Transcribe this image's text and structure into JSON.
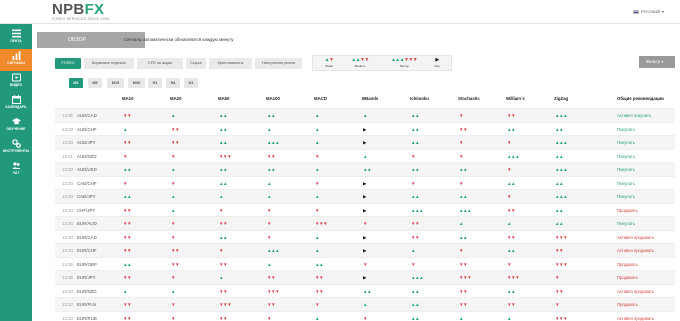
{
  "logo": {
    "text_main": "NPB",
    "text_fx": "FX",
    "subtitle": "FOREX SERVICES SINCE 1994"
  },
  "language": {
    "label": "РУССКИЙ",
    "arrow": "▾"
  },
  "sidebar": {
    "items": [
      {
        "label": "ЛЕНТА",
        "icon": "feed-icon",
        "active": false
      },
      {
        "label": "СИГНАЛЫ",
        "icon": "chart-icon",
        "active": true
      },
      {
        "label": "ВИДЕО",
        "icon": "video-icon",
        "active": false
      },
      {
        "label": "КАЛЕНДАРЬ",
        "icon": "calendar-icon",
        "active": false
      },
      {
        "label": "ОБУЧЕНИЕ",
        "icon": "education-icon",
        "active": false
      },
      {
        "label": "ИНСТРУМЕНТЫ",
        "icon": "tools-icon",
        "active": false
      },
      {
        "label": "ЧАТ",
        "icon": "chat-icon",
        "active": false
      }
    ]
  },
  "overview": {
    "tab_label": "ОБЗОР",
    "note": "Сигналы автоматически обновляются каждую минуту"
  },
  "categories": [
    "FOREX",
    "Биржевые индексы",
    "CFD на акции",
    "Сырье",
    "Криптовалюты",
    "Настроения рынка"
  ],
  "legend": [
    {
      "label": "Weak",
      "arrows": "▲▼",
      "colors": [
        "#2aa27c",
        "#d64545"
      ]
    },
    {
      "label": "Medium",
      "arrows": "▲▲▼▼",
      "colors": [
        "#2aa27c",
        "#d64545"
      ]
    },
    {
      "label": "Strong",
      "arrows": "▲▲▲▼▼▼",
      "colors": [
        "#2aa27c",
        "#d64545"
      ]
    },
    {
      "label": "Flat",
      "arrows": "▶",
      "colors": [
        "#111",
        "#111"
      ]
    }
  ],
  "filter": {
    "label": "Фильтр",
    "arrow": "▾"
  },
  "timeframes": [
    "M1",
    "M5",
    "M15",
    "M30",
    "H1",
    "H4",
    "D1"
  ],
  "table": {
    "columns": [
      "MA10",
      "MA20",
      "MA50",
      "MA100",
      "MACD",
      "BBands",
      "Ichimoku",
      "Stochastic",
      "William`s",
      "ZigZag",
      "Общие рекомендации"
    ],
    "rows": [
      {
        "time": "13:35",
        "pair": "AUD/CAD",
        "signals": [
          "vv",
          "^",
          "^^",
          "^^",
          "^",
          "^",
          "^^",
          "v",
          "vv",
          "^^^"
        ],
        "rec": "Активно покупать",
        "rec_type": "buy"
      },
      {
        "time": "13:33",
        "pair": "AUD/CHF",
        "signals": [
          "^",
          "vv",
          "^^",
          "^",
          "^",
          ">",
          "^^",
          "vv",
          "^^",
          "^^"
        ],
        "rec": "Покупать",
        "rec_type": "buy"
      },
      {
        "time": "13:33",
        "pair": "AUD/JPY",
        "signals": [
          "vv",
          "vv",
          "^^",
          "^^^",
          "^",
          ">",
          "^^",
          "v",
          "v",
          "^^^"
        ],
        "rec": "Покупать",
        "rec_type": "buy"
      },
      {
        "time": "13:21",
        "pair": "AUD/NZD",
        "signals": [
          "v",
          "v",
          "vvv",
          "vv",
          "v",
          "^",
          "v",
          "v",
          "^^^",
          "^^"
        ],
        "rec": "Покупать",
        "rec_type": "buy"
      },
      {
        "time": "13:33",
        "pair": "AUD/USD",
        "signals": [
          "^^",
          "^",
          "^^",
          "^^",
          "^",
          "^^",
          "^^",
          "^^",
          "v",
          "^^^"
        ],
        "rec": "Покупать",
        "rec_type": "buy"
      },
      {
        "time": "13:33",
        "pair": "CAD/CHF",
        "signals": [
          "v",
          "v",
          "^^",
          "^",
          "v",
          ">",
          "v",
          "v",
          "^^",
          "^^"
        ],
        "rec": "Покупать",
        "rec_type": "buy"
      },
      {
        "time": "13:33",
        "pair": "CAD/JPY",
        "signals": [
          "^^",
          "^",
          "^",
          "^",
          "^",
          ">",
          "^^",
          "^^",
          "v",
          "^^^"
        ],
        "rec": "Покупать",
        "rec_type": "buy"
      },
      {
        "time": "13:34",
        "pair": "CHF/JPY",
        "signals": [
          "vv",
          "^",
          "v",
          "v",
          "v",
          ">",
          "^^^",
          "^^^",
          "vv",
          "^^"
        ],
        "rec": "Продавать",
        "rec_type": "sell"
      },
      {
        "time": "13:34",
        "pair": "EUR/AUD",
        "signals": [
          "vv",
          "v",
          "vv",
          "v",
          "vvv",
          "v",
          "vv",
          "^",
          "^",
          "^^"
        ],
        "rec": "Покупать",
        "rec_type": "buy"
      },
      {
        "time": "13:34",
        "pair": "EUR/CAD",
        "signals": [
          "vv",
          "v",
          "^^",
          "v",
          "^",
          ">",
          "vv",
          "^^",
          "vv",
          "vvv"
        ],
        "rec": "Активно продавать",
        "rec_type": "sell"
      },
      {
        "time": "13:34",
        "pair": "EUR/CHF",
        "signals": [
          "vv",
          "vv",
          "v",
          "^^^",
          "^",
          ">",
          "^",
          "v",
          "^^",
          "vv"
        ],
        "rec": "Активно продавать",
        "rec_type": "sell"
      },
      {
        "time": "13:35",
        "pair": "EUR/GBP",
        "signals": [
          "^^",
          "vv",
          "vv",
          "^",
          "^^",
          "v",
          "v",
          "vv",
          "v",
          "vvv"
        ],
        "rec": "Продавать",
        "rec_type": "sell"
      },
      {
        "time": "13:35",
        "pair": "EUR/JPY",
        "signals": [
          "vv",
          "v",
          "^",
          "vv",
          "vv",
          ">",
          "^^^",
          "vvv",
          "vvv",
          "v"
        ],
        "rec": "Продавать",
        "rec_type": "sell"
      },
      {
        "time": "13:34",
        "pair": "EUR/NZD",
        "signals": [
          "^",
          "^",
          "vv",
          "vvv",
          "vv",
          "^^",
          "^^",
          "vv",
          "^^",
          "vv"
        ],
        "rec": "Активно продавать",
        "rec_type": "sell"
      },
      {
        "time": "13:22",
        "pair": "EUR/PLN",
        "signals": [
          "vv",
          "v",
          "vvv",
          "vv",
          "v",
          "^",
          "^^",
          "vv",
          "vv",
          "v"
        ],
        "rec": "Продавать",
        "rec_type": "sell"
      },
      {
        "time": "13:23",
        "pair": "EUR/RUB",
        "signals": [
          "vv",
          "v",
          "vv",
          "v",
          "^",
          "v",
          "^^",
          "^",
          "^",
          "vvv"
        ],
        "rec": "Активно продавать",
        "rec_type": "sell"
      }
    ]
  },
  "colors": {
    "accent": "#22997a",
    "active": "#f08a2a",
    "buy": "#2aa27c",
    "sell": "#d64545",
    "flat": "#111111"
  }
}
